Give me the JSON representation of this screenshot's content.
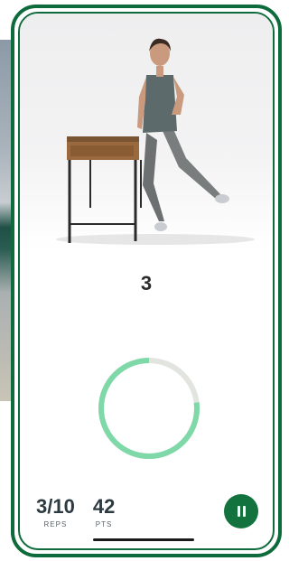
{
  "workout": {
    "countdown": "3",
    "progress_fraction": 0.77
  },
  "stats": {
    "reps_value": "3/10",
    "reps_label": "REPS",
    "points_value": "42",
    "points_label": "PTS"
  },
  "colors": {
    "frame": "#0e6b3b",
    "ring_progress": "#7fd8a8",
    "ring_track": "#e2e4e0",
    "pause_button": "#13733f"
  },
  "icons": {
    "pause": "pause-icon"
  }
}
